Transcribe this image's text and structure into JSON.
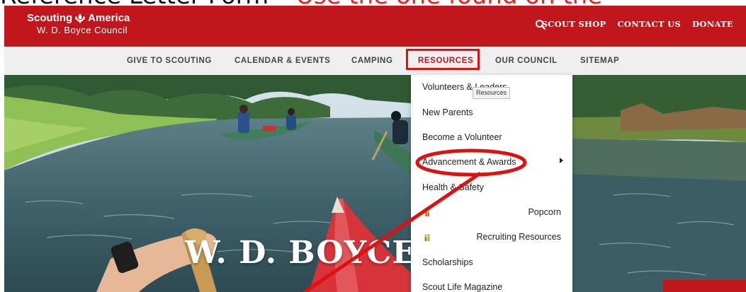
{
  "caption": {
    "part1": "Reference Letter Form",
    "separator": " – ",
    "part2": "Use the one found on the"
  },
  "header": {
    "brand_line1_left": "Scouting",
    "brand_line1_right": "America",
    "brand_line2": "W. D. Boyce Council",
    "top_links": [
      "SCOUT SHOP",
      "CONTACT US",
      "DONATE"
    ]
  },
  "nav": {
    "items": [
      "GIVE TO SCOUTING",
      "CALENDAR & EVENTS",
      "CAMPING",
      "RESOURCES",
      "OUR COUNCIL",
      "SITEMAP"
    ],
    "active": "RESOURCES"
  },
  "hero": {
    "title": "W. D. BOYCE"
  },
  "dropdown": {
    "items": [
      "Volunteers & Leaders",
      "New Parents",
      "Become a Volunteer",
      "Advancement & Awards",
      "Health & Safety",
      "Popcorn",
      "Recruiting Resources",
      "Scholarships",
      "Scout Life Magazine"
    ],
    "tooltip": "Resources"
  },
  "colors": {
    "brand_red": "#c0161c",
    "annotation_red": "#e01010"
  }
}
